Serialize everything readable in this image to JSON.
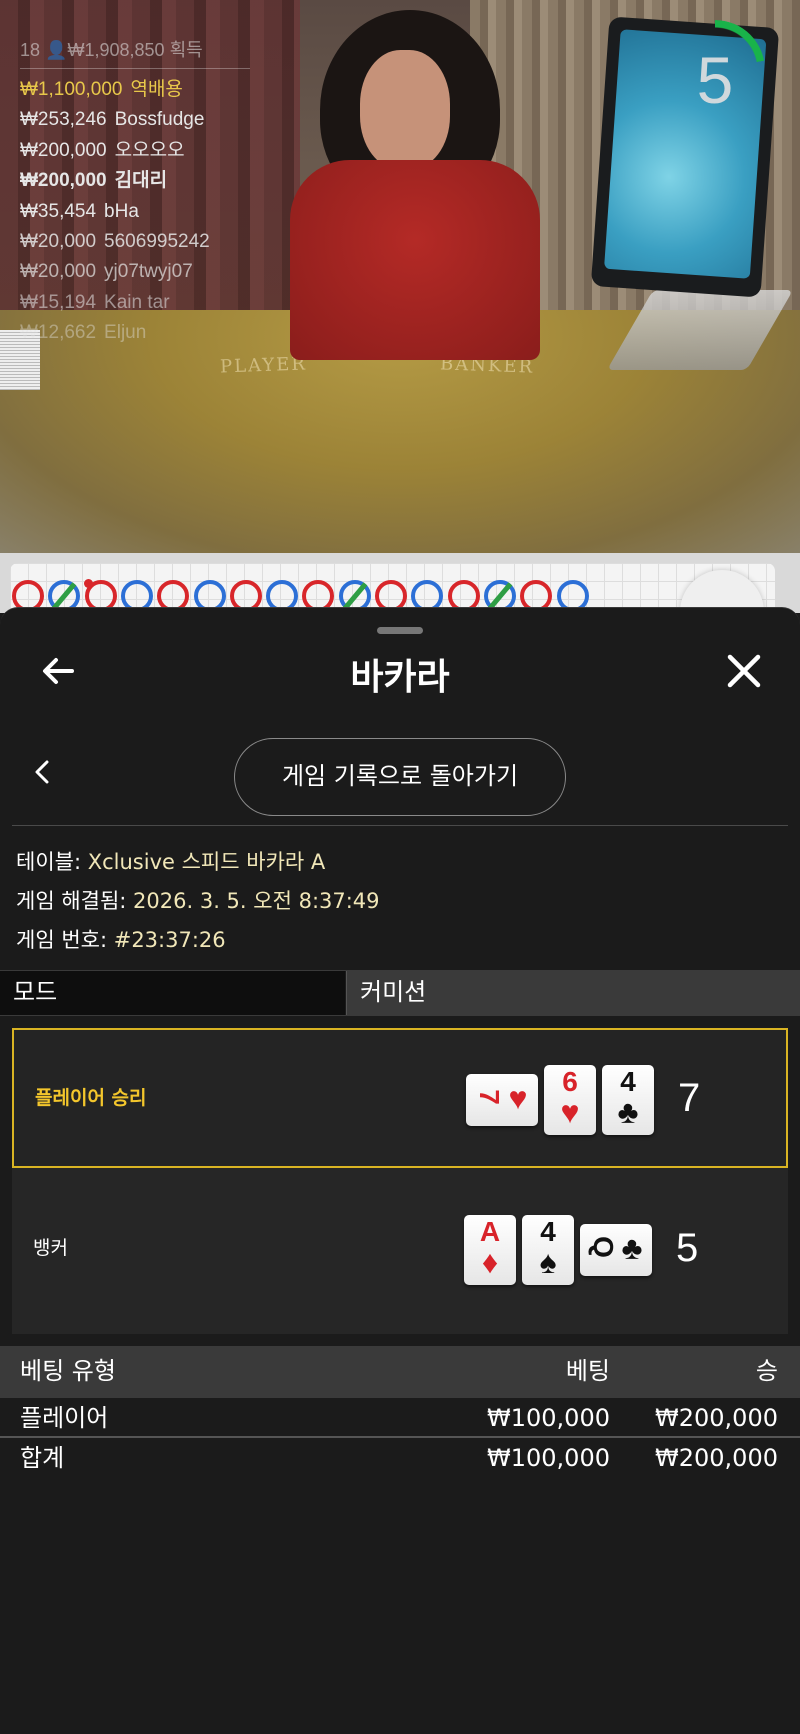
{
  "video": {
    "countdown": "5",
    "felt_player": "PLAYER",
    "felt_banker": "BANKER",
    "winners_header": {
      "count": "18",
      "amount": "₩1,908,850",
      "suffix": "획득"
    },
    "winners": [
      {
        "amount": "₩1,100,000",
        "name": "역배용",
        "style": "gold"
      },
      {
        "amount": "₩253,246",
        "name": "Bossfudge",
        "style": ""
      },
      {
        "amount": "₩200,000",
        "name": "오오오오",
        "style": ""
      },
      {
        "amount": "₩200,000",
        "name": "김대리",
        "style": "bold"
      },
      {
        "amount": "₩35,454",
        "name": "bHa",
        "style": ""
      },
      {
        "amount": "₩20,000",
        "name": "5606995242",
        "style": "dim1"
      },
      {
        "amount": "₩20,000",
        "name": "yj07twyj07",
        "style": "dim2"
      },
      {
        "amount": "₩15,194",
        "name": "Kain tar",
        "style": "dim3"
      },
      {
        "amount": "₩12,662",
        "name": "Eljun",
        "style": "dim4"
      }
    ]
  },
  "roadmap": {
    "beads": [
      "r",
      "b-tie",
      "r-pair",
      "b",
      "r",
      "b",
      "r",
      "b",
      "r",
      "b-tie",
      "r",
      "b",
      "r",
      "b-tie",
      "r",
      "b"
    ]
  },
  "sheet": {
    "title": "바카라",
    "back_icon": "arrow-left-icon",
    "close_icon": "close-icon",
    "history_button": "게임 기록으로 돌아가기",
    "info": {
      "table_label": "테이블:",
      "table_value": "Xclusive 스피드 바카라 A",
      "resolved_label": "게임 해결됨:",
      "resolved_value": "2026. 3. 5. 오전 8:37:49",
      "game_no_label": "게임 번호:",
      "game_no_value": "#23:37:26"
    },
    "tabs": {
      "mode": "모드",
      "commission": "커미션"
    },
    "player": {
      "label": "플레이어 승리",
      "score": "7",
      "cards": [
        {
          "rank": "7",
          "suit": "♥",
          "color": "red",
          "sideways": true
        },
        {
          "rank": "6",
          "suit": "♥",
          "color": "red",
          "sideways": false
        },
        {
          "rank": "4",
          "suit": "♣",
          "color": "blk",
          "sideways": false
        }
      ]
    },
    "banker": {
      "label": "뱅커",
      "score": "5",
      "cards": [
        {
          "rank": "A",
          "suit": "♦",
          "color": "red",
          "sideways": false
        },
        {
          "rank": "4",
          "suit": "♠",
          "color": "blk",
          "sideways": false
        },
        {
          "rank": "Q",
          "suit": "♣",
          "color": "blk",
          "sideways": true
        }
      ]
    },
    "bets": {
      "headers": {
        "type": "베팅 유형",
        "bet": "베팅",
        "win": "승"
      },
      "rows": [
        {
          "type": "플레이어",
          "bet": "₩100,000",
          "win": "₩200,000"
        }
      ],
      "total": {
        "type": "합계",
        "bet": "₩100,000",
        "win": "₩200,000"
      }
    }
  }
}
